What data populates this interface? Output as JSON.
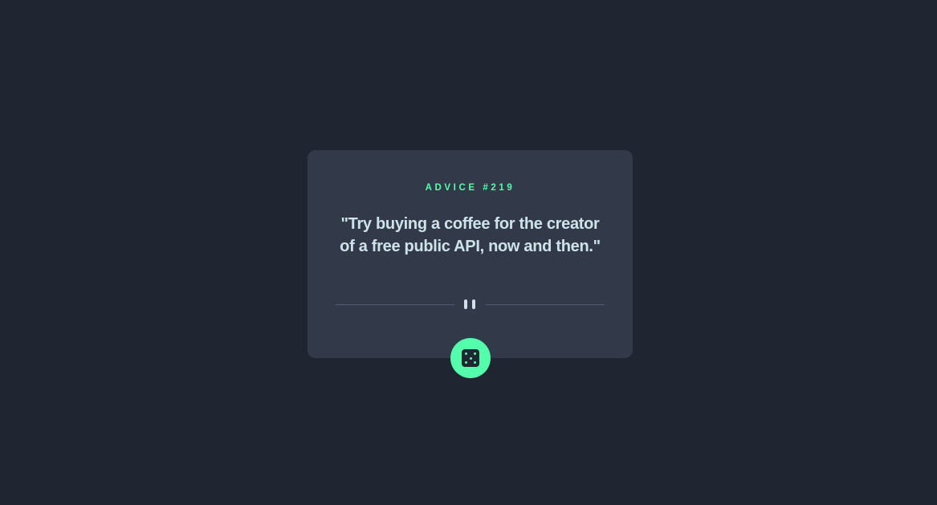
{
  "card": {
    "advice_id_label": "ADVICE #219",
    "advice_text": "\"Try buying a coffee for the creator of a free public API, now and then.\""
  },
  "divider": {
    "icon": "pause-icon"
  },
  "button": {
    "icon": "dice-icon"
  },
  "colors": {
    "background": "#1f2531",
    "card": "#323a49",
    "accent": "#53ffab",
    "text": "#cee3e9",
    "divider": "#4f5d74"
  }
}
